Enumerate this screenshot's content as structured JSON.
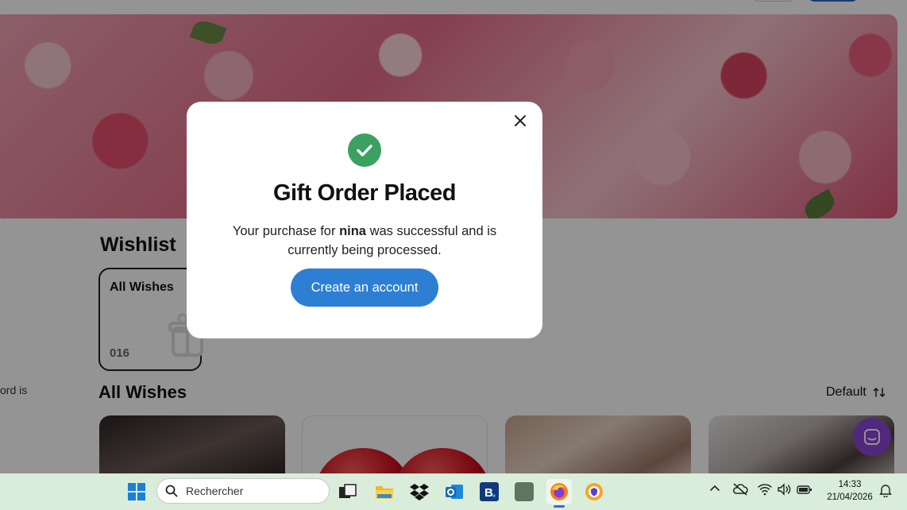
{
  "page": {
    "wishlist_title": "Wishlist",
    "all_wishes_card": {
      "label": "All Wishes",
      "count": "016"
    },
    "side_text": "ord is",
    "all_wishes_heading": "All Wishes",
    "sort_label": "Default"
  },
  "modal": {
    "title": "Gift Order Placed",
    "message_before": "Your purchase for",
    "recipient": "nina",
    "message_after": "was successful and is currently being processed.",
    "cta_label": "Create an account",
    "icons": {
      "close": "close-icon",
      "success": "check-circle-icon"
    }
  },
  "taskbar": {
    "search_placeholder": "Rechercher",
    "time": "14:33",
    "date": "21/04/2026",
    "apps": [
      "start",
      "search",
      "task-view",
      "file-explorer",
      "dropbox",
      "outlook",
      "booking",
      "app-grey",
      "firefox",
      "vpn-shield"
    ]
  },
  "colors": {
    "cta": "#2d7fd3",
    "success": "#3aa160",
    "chat": "#8a45d6",
    "taskbar": "#d9edda"
  }
}
